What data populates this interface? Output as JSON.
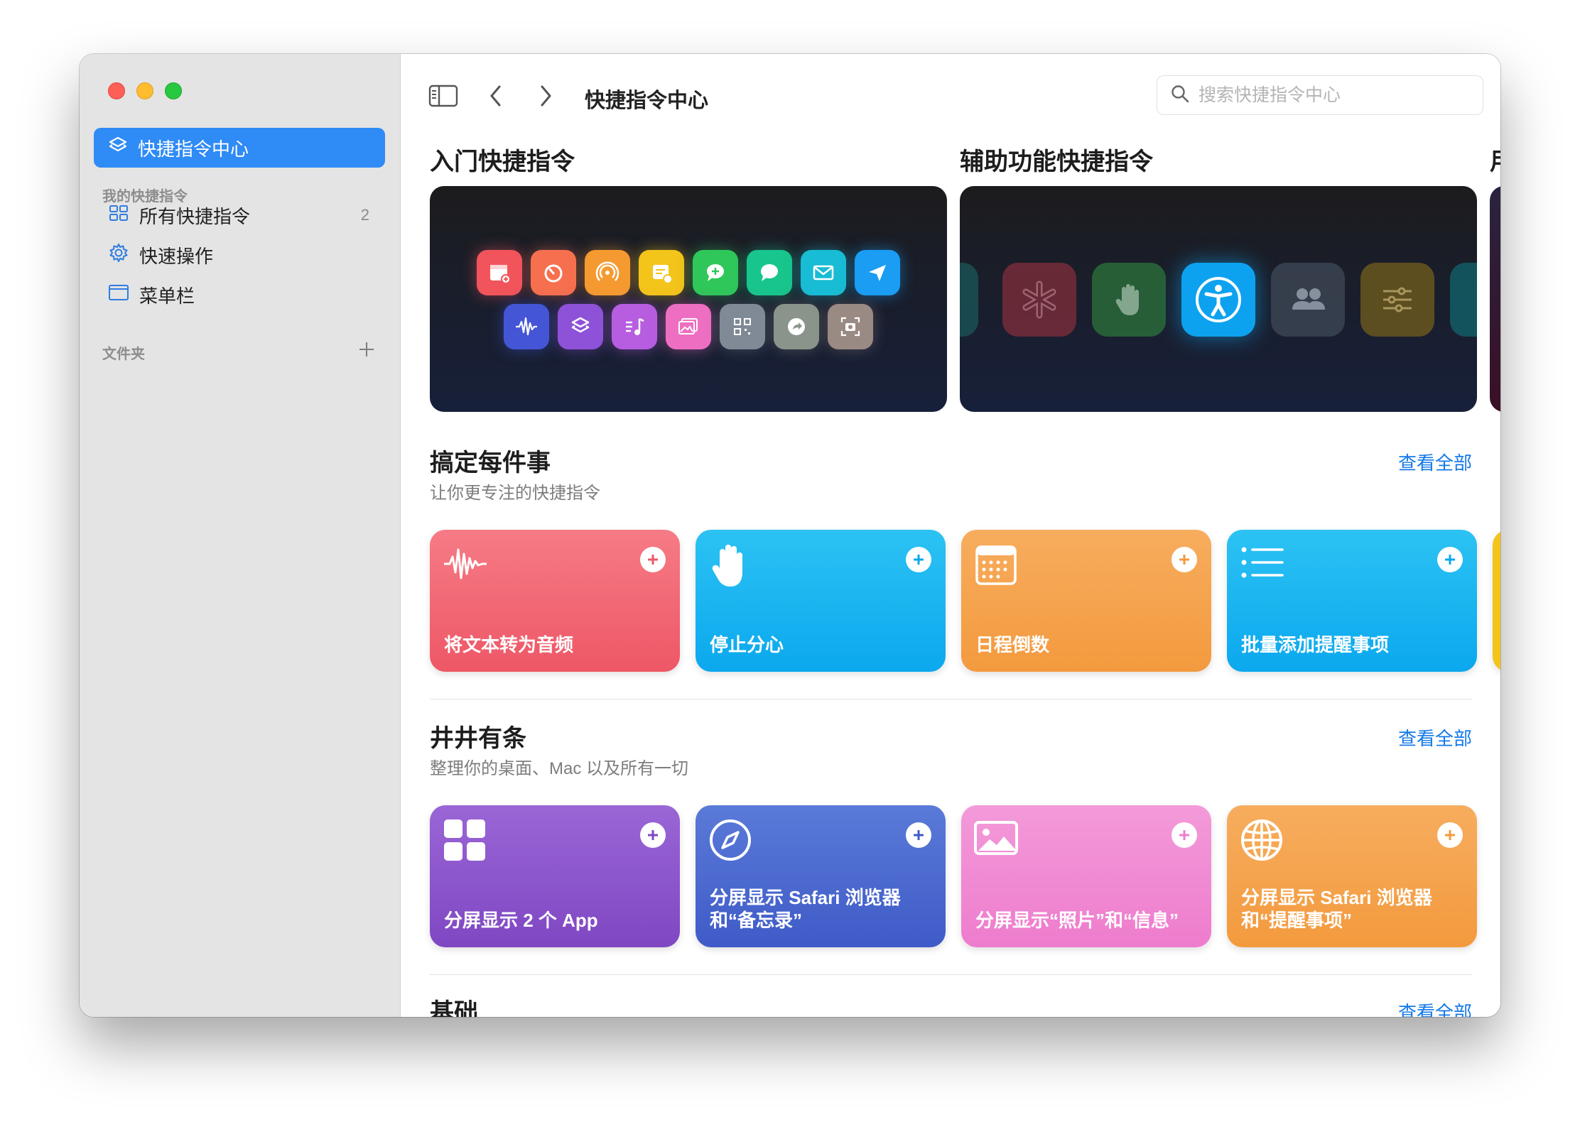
{
  "window": {
    "traffic_lights": [
      "close",
      "minimize",
      "zoom"
    ]
  },
  "sidebar": {
    "gallery_label": "快捷指令中心",
    "my_shortcuts_header": "我的快捷指令",
    "items": [
      {
        "label": "所有快捷指令",
        "count": "2",
        "icon": "grid-icon"
      },
      {
        "label": "快速操作",
        "icon": "gear-icon"
      },
      {
        "label": "菜单栏",
        "icon": "menubar-icon"
      }
    ],
    "folders_header": "文件夹"
  },
  "toolbar": {
    "title": "快捷指令中心",
    "search_placeholder": "搜索快捷指令中心"
  },
  "hero": {
    "sections": [
      {
        "title": "入门快捷指令"
      },
      {
        "title": "辅助功能快捷指令"
      },
      {
        "title": "用"
      }
    ]
  },
  "sections": [
    {
      "title": "搞定每件事",
      "subtitle": "让你更专注的快捷指令",
      "see_all": "查看全部",
      "cards": [
        {
          "label": "将文本转为音频",
          "icon": "waveform-icon",
          "color_top": "#f67b86",
          "color_bottom": "#ee5766"
        },
        {
          "label": "停止分心",
          "icon": "hand-icon",
          "color_top": "#2cc2f3",
          "color_bottom": "#0ba8ee"
        },
        {
          "label": "日程倒数",
          "icon": "calendar-icon",
          "color_top": "#f7ad5e",
          "color_bottom": "#f39a3e"
        },
        {
          "label": "批量添加提醒事项",
          "icon": "list-icon",
          "color_top": "#2cc2f3",
          "color_bottom": "#0ba8ee"
        }
      ]
    },
    {
      "title": "井井有条",
      "subtitle": "整理你的桌面、Mac 以及所有一切",
      "see_all": "查看全部",
      "cards": [
        {
          "label": "分屏显示 2 个 App",
          "icon": "apps-grid-icon",
          "color_top": "#9a66d6",
          "color_bottom": "#7f47c2"
        },
        {
          "label": "分屏显示 Safari 浏览器和“备忘录”",
          "icon": "compass-icon",
          "color_top": "#5a7ad8",
          "color_bottom": "#3f5bc8"
        },
        {
          "label": "分屏显示“照片”和“信息”",
          "icon": "photo-icon",
          "color_top": "#f39ad9",
          "color_bottom": "#ee7ccd"
        },
        {
          "label": "分屏显示 Safari 浏览器和“提醒事项”",
          "icon": "globe-icon",
          "color_top": "#f7ad5e",
          "color_bottom": "#f39a3e"
        }
      ]
    },
    {
      "title": "基础",
      "see_all": "查看全部"
    }
  ]
}
